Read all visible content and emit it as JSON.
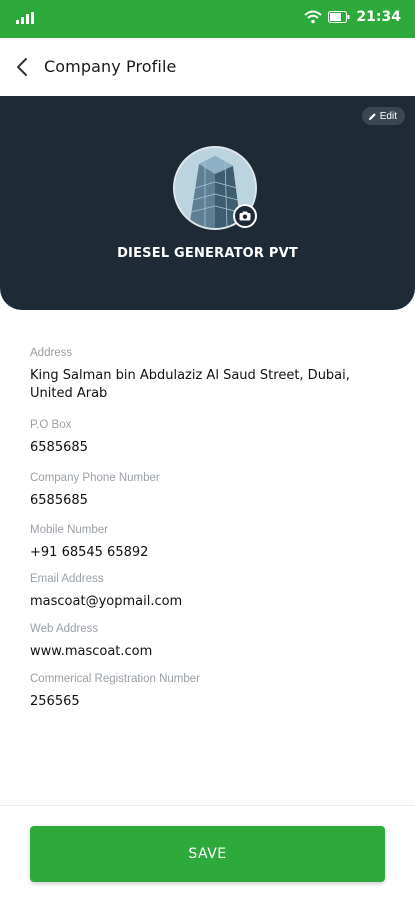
{
  "status": {
    "time": "21:34",
    "icons": [
      "signal-icon",
      "wifi-icon",
      "battery-icon"
    ],
    "bar_color": "#2eaa3c"
  },
  "header": {
    "title": "Company Profile",
    "back_icon": "chevron-left-icon"
  },
  "profile": {
    "edit_label": "Edit",
    "edit_icon": "pencil-icon",
    "company_name": "DIESEL GENERATOR PVT",
    "camera_icon": "camera-icon",
    "background_color": "#1e2a35"
  },
  "fields": {
    "address": {
      "label": "Address",
      "value": "King Salman bin Abdulaziz Al Saud Street, Dubai, United Arab"
    },
    "po_box": {
      "label": "P.O Box",
      "value": "6585685"
    },
    "company_phone": {
      "label": "Company Phone Number",
      "value": "6585685"
    },
    "mobile": {
      "label": "Mobile Number",
      "value": "+91 68545 65892"
    },
    "email": {
      "label": "Email Address",
      "value": "mascoat@yopmail.com"
    },
    "web": {
      "label": "Web Address",
      "value": "www.mascoat.com"
    },
    "commercial_reg": {
      "label": "Commerical Registration Number",
      "value": "256565"
    }
  },
  "actions": {
    "save_label": "SAVE",
    "accent": "#2eaa3c"
  }
}
